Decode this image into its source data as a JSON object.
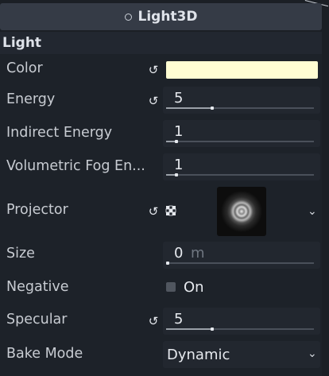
{
  "header": {
    "title": "Light3D",
    "node_icon": "circle-node-icon"
  },
  "section": {
    "title": "Light"
  },
  "properties": {
    "color": {
      "label": "Color",
      "value_hex": "#fffdd3",
      "revertable": true
    },
    "energy": {
      "label": "Energy",
      "value": "5",
      "fraction": 0.3,
      "revertable": true
    },
    "indirect_energy": {
      "label": "Indirect Energy",
      "value": "1",
      "fraction": 0.06
    },
    "volumetric_fog": {
      "label": "Volumetric Fog En...",
      "value": "1",
      "fraction": 0.06
    },
    "projector": {
      "label": "Projector",
      "revertable": true,
      "texture": "radial-ring-texture"
    },
    "size": {
      "label": "Size",
      "value": "0",
      "unit": "m",
      "fraction": 0.0
    },
    "negative": {
      "label": "Negative",
      "checkbox_label": "On",
      "checked": false
    },
    "specular": {
      "label": "Specular",
      "value": "5",
      "fraction": 0.3,
      "revertable": true
    },
    "bake_mode": {
      "label": "Bake Mode",
      "value": "Dynamic"
    }
  },
  "colors": {
    "background": "#1d2229",
    "header": "#353b46",
    "field": "#22272f",
    "text": "#c8ccd2"
  }
}
